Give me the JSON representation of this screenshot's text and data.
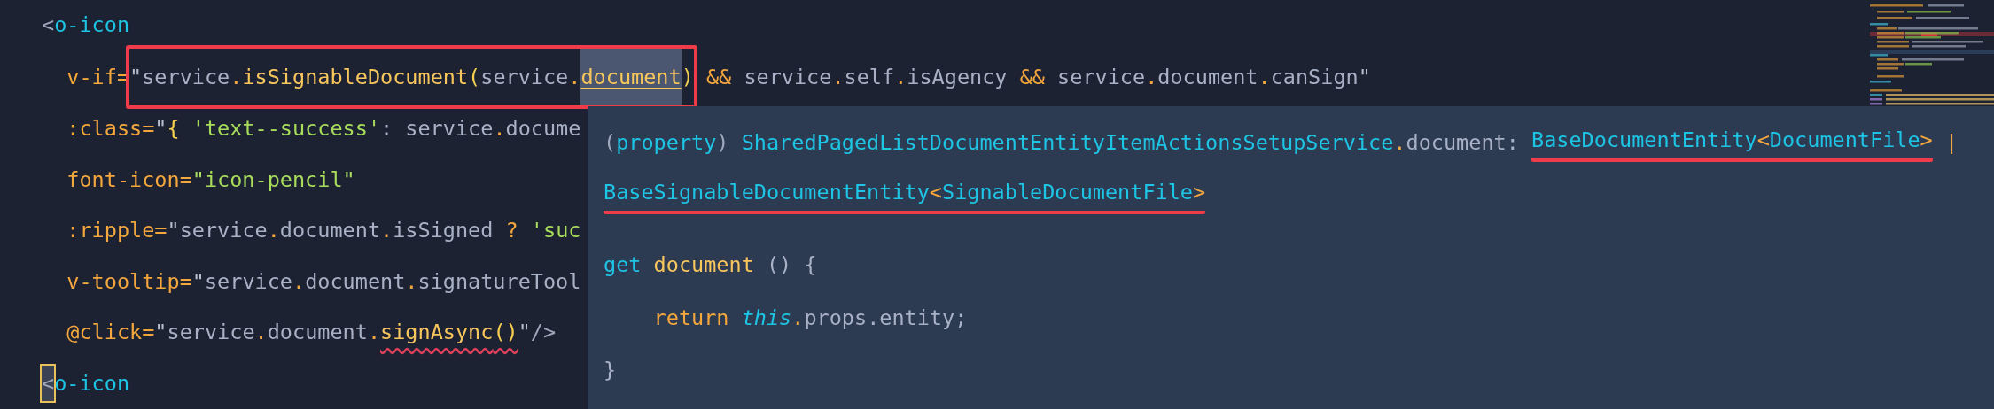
{
  "editor": {
    "lines": [
      {
        "segments": [
          {
            "kind": "plain",
            "tokens": [
              {
                "text": "<",
                "kind": "punct"
              },
              {
                "text": "o-icon",
                "kind": "tag"
              }
            ]
          }
        ]
      },
      {
        "segments": [
          {
            "kind": "plain",
            "tokens": [
              {
                "text": "  v-if=",
                "kind": "attr"
              }
            ]
          },
          {
            "kind": "boxed",
            "tokens": [
              {
                "text": "\"",
                "kind": "quote"
              },
              {
                "text": "service",
                "kind": "plain"
              },
              {
                "text": ".",
                "kind": "dot"
              },
              {
                "text": "isSignableDocument",
                "kind": "method"
              },
              {
                "text": "(",
                "kind": "bracket"
              },
              {
                "text": "service",
                "kind": "plain"
              },
              {
                "text": ".",
                "kind": "dot"
              },
              {
                "text": "document",
                "kind": "hover"
              },
              {
                "text": ")",
                "kind": "bracket"
              }
            ]
          },
          {
            "kind": "plain",
            "tokens": [
              {
                "text": " && ",
                "kind": "op"
              },
              {
                "text": "service",
                "kind": "plain"
              },
              {
                "text": ".",
                "kind": "dot"
              },
              {
                "text": "self",
                "kind": "plain"
              },
              {
                "text": ".",
                "kind": "dot"
              },
              {
                "text": "isAgency",
                "kind": "plain"
              },
              {
                "text": " && ",
                "kind": "op"
              },
              {
                "text": "service",
                "kind": "plain"
              },
              {
                "text": ".",
                "kind": "dot"
              },
              {
                "text": "document",
                "kind": "plain"
              },
              {
                "text": ".",
                "kind": "dot"
              },
              {
                "text": "canSign",
                "kind": "plain"
              },
              {
                "text": "\"",
                "kind": "quote"
              }
            ]
          }
        ]
      },
      {
        "segments": [
          {
            "kind": "plain",
            "tokens": [
              {
                "text": "  :class=",
                "kind": "attr"
              },
              {
                "text": "\"",
                "kind": "quote"
              },
              {
                "text": "{",
                "kind": "bracket"
              },
              {
                "text": " 'text--success'",
                "kind": "string"
              },
              {
                "text": ": service",
                "kind": "plain"
              },
              {
                "text": ".",
                "kind": "dot"
              },
              {
                "text": "docume",
                "kind": "plain"
              }
            ]
          }
        ]
      },
      {
        "segments": [
          {
            "kind": "plain",
            "tokens": [
              {
                "text": "  font-icon=",
                "kind": "attr"
              },
              {
                "text": "\"icon-pencil\"",
                "kind": "string"
              }
            ]
          }
        ]
      },
      {
        "segments": [
          {
            "kind": "plain",
            "tokens": [
              {
                "text": "  :ripple=",
                "kind": "attr"
              },
              {
                "text": "\"",
                "kind": "quote"
              },
              {
                "text": "service",
                "kind": "plain"
              },
              {
                "text": ".",
                "kind": "dot"
              },
              {
                "text": "document",
                "kind": "plain"
              },
              {
                "text": ".",
                "kind": "dot"
              },
              {
                "text": "isSigned ",
                "kind": "plain"
              },
              {
                "text": "?",
                "kind": "op"
              },
              {
                "text": " 'suc",
                "kind": "string"
              }
            ]
          }
        ]
      },
      {
        "segments": [
          {
            "kind": "plain",
            "tokens": [
              {
                "text": "  v-tooltip=",
                "kind": "attr"
              },
              {
                "text": "\"",
                "kind": "quote"
              },
              {
                "text": "service",
                "kind": "plain"
              },
              {
                "text": ".",
                "kind": "dot"
              },
              {
                "text": "document",
                "kind": "plain"
              },
              {
                "text": ".",
                "kind": "dot"
              },
              {
                "text": "signatureTool",
                "kind": "plain"
              }
            ]
          }
        ]
      },
      {
        "segments": [
          {
            "kind": "plain",
            "tokens": [
              {
                "text": "  @click=",
                "kind": "attr"
              },
              {
                "text": "\"",
                "kind": "quote"
              },
              {
                "text": "service",
                "kind": "plain"
              },
              {
                "text": ".",
                "kind": "dot"
              },
              {
                "text": "document",
                "kind": "plain"
              },
              {
                "text": ".",
                "kind": "dot"
              },
              {
                "text": "signAsync",
                "kind": "error-method"
              },
              {
                "text": "()",
                "kind": "error-bracket"
              },
              {
                "text": "\"",
                "kind": "quote"
              },
              {
                "text": "/>",
                "kind": "punct"
              }
            ]
          }
        ]
      },
      {
        "segments": [
          {
            "kind": "plain",
            "tokens": [
              {
                "text": "<",
                "kind": "cursor"
              },
              {
                "text": "o-icon",
                "kind": "tag"
              }
            ]
          }
        ]
      }
    ]
  },
  "hover_tooltip": {
    "signature": [
      {
        "segments": [
          {
            "kind": "plain",
            "tokens": [
              {
                "text": "(",
                "kind": "punct"
              },
              {
                "text": "property",
                "kind": "type"
              },
              {
                "text": ") ",
                "kind": "punct"
              },
              {
                "text": "SharedPagedListDocumentEntityItemActionsSetupService",
                "kind": "type"
              },
              {
                "text": ".",
                "kind": "dot"
              },
              {
                "text": "document: ",
                "kind": "plain"
              }
            ]
          },
          {
            "kind": "underlined",
            "tokens": [
              {
                "text": "BaseDocumentEntity",
                "kind": "type"
              },
              {
                "text": "<",
                "kind": "op"
              },
              {
                "text": "DocumentFile",
                "kind": "type"
              },
              {
                "text": ">",
                "kind": "op"
              }
            ]
          },
          {
            "kind": "plain",
            "tokens": [
              {
                "text": " |",
                "kind": "op"
              }
            ]
          }
        ]
      },
      {
        "segments": [
          {
            "kind": "underlined",
            "tokens": [
              {
                "text": "BaseSignableDocumentEntity",
                "kind": "type"
              },
              {
                "text": "<",
                "kind": "op"
              },
              {
                "text": "SignableDocumentFile",
                "kind": "type"
              },
              {
                "text": ">",
                "kind": "op"
              }
            ]
          }
        ]
      }
    ],
    "code": [
      {
        "segments": [
          {
            "kind": "plain",
            "tokens": [
              {
                "text": "get",
                "kind": "type"
              },
              {
                "text": " document",
                "kind": "method"
              },
              {
                "text": " () {",
                "kind": "plain"
              }
            ]
          }
        ]
      },
      {
        "segments": [
          {
            "kind": "plain",
            "tokens": [
              {
                "text": "    return",
                "kind": "attr"
              },
              {
                "text": " this",
                "kind": "this"
              },
              {
                "text": ".",
                "kind": "dot"
              },
              {
                "text": "props.entity;",
                "kind": "plain"
              }
            ]
          }
        ]
      },
      {
        "segments": [
          {
            "kind": "plain",
            "tokens": [
              {
                "text": "}",
                "kind": "plain"
              }
            ]
          }
        ]
      }
    ]
  }
}
